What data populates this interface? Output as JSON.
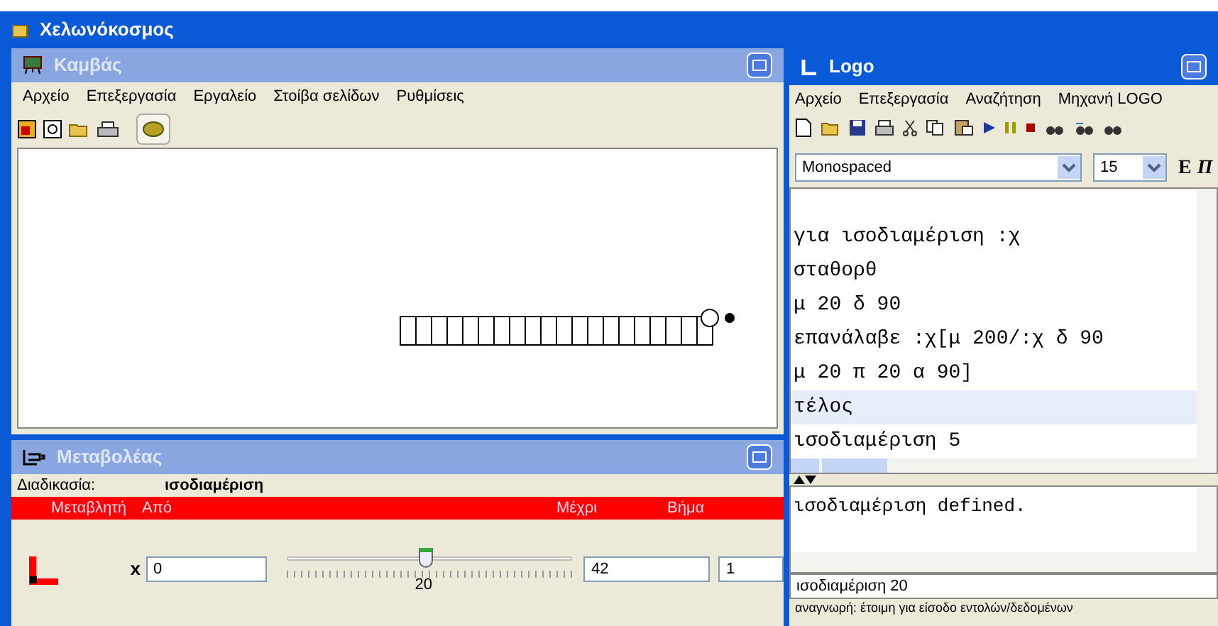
{
  "window": {
    "title": "Χελωνόκοσμος"
  },
  "canvas_window": {
    "title": "Καμβάς",
    "menu": [
      "Αρχείο",
      "Επεξεργασία",
      "Εργαλείο",
      "Στοίβα σελίδων",
      "Ρυθμίσεις"
    ]
  },
  "variator_window": {
    "title": "Μεταβολέας",
    "procedure_label": "Διαδικασία:",
    "procedure_name": "ισοδιαμέριση",
    "columns": [
      "Μεταβλητή",
      "Από",
      "Μέχρι",
      "Βήμα"
    ],
    "variables": [
      {
        "name": "x",
        "from": "0",
        "to": "42",
        "step": "1",
        "value_label": "20",
        "level": 0.476
      }
    ]
  },
  "logo_window": {
    "title": "Logo",
    "menu": [
      "Αρχείο",
      "Επεξεργασία",
      "Αναζήτηση",
      "Μηχανή LOGO"
    ],
    "font": "Monospaced",
    "font_size": "15",
    "style_buttons": [
      "Ε",
      "Π"
    ],
    "editor_lines": [
      {
        "text": "για ισοδιαμέριση :χ",
        "highlighted": false
      },
      {
        "text": "σταθορθ",
        "highlighted": false
      },
      {
        "text": "μ 20 δ 90",
        "highlighted": false
      },
      {
        "text": "επανάλαβε :χ[μ 200/:χ δ 90",
        "highlighted": false
      },
      {
        "text": "μ 20 π 20 α 90]",
        "highlighted": false
      },
      {
        "text": "τέλος",
        "highlighted": true
      },
      {
        "text": "ισοδιαμέριση 5",
        "highlighted": false
      }
    ],
    "output_lines": [
      "ισοδιαμέριση defined."
    ],
    "command_input": "ισοδιαμέριση 20",
    "status": "αναγνωρή: έτοιμη για είσοδο εντολών/δεδομένων"
  }
}
